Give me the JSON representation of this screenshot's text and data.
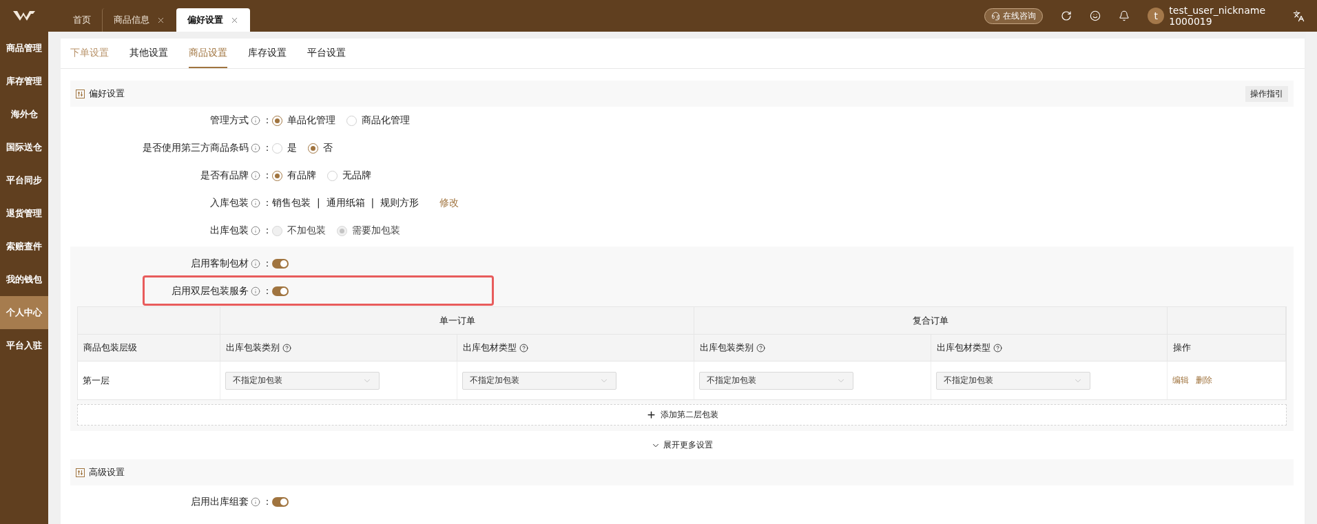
{
  "top_bar": {
    "tabs": [
      {
        "label": "首页",
        "selected": false,
        "closable": false
      },
      {
        "label": "商品信息",
        "selected": false,
        "closable": true
      },
      {
        "label": "偏好设置",
        "selected": true,
        "closable": true
      }
    ],
    "consult_button": "在线咨询",
    "user": {
      "avatar": "t",
      "name": "test_user_nickname",
      "id": "1000019"
    }
  },
  "sidebar": {
    "items": [
      {
        "label": "商品管理",
        "selected": false
      },
      {
        "label": "库存管理",
        "selected": false
      },
      {
        "label": "海外仓",
        "selected": false
      },
      {
        "label": "国际送仓",
        "selected": false
      },
      {
        "label": "平台同步",
        "selected": false
      },
      {
        "label": "退货管理",
        "selected": false
      },
      {
        "label": "索赔查件",
        "selected": false
      },
      {
        "label": "我的钱包",
        "selected": false
      },
      {
        "label": "个人中心",
        "selected": true
      },
      {
        "label": "平台入驻",
        "selected": false
      }
    ]
  },
  "page_tabs": [
    {
      "label": "下单设置",
      "selected": false,
      "hovered": true
    },
    {
      "label": "其他设置",
      "selected": false,
      "hovered": false
    },
    {
      "label": "商品设置",
      "selected": true,
      "hovered": false
    },
    {
      "label": "库存设置",
      "selected": false,
      "hovered": false
    },
    {
      "label": "平台设置",
      "selected": false,
      "hovered": false
    }
  ],
  "preferences": {
    "title": "偏好设置",
    "guide_button": "操作指引",
    "fields": [
      {
        "kind": "radio",
        "label": "管理方式",
        "colon": "：",
        "options": [
          {
            "label": "单品化管理",
            "selected": true,
            "disabled": false
          },
          {
            "label": "商品化管理",
            "selected": false,
            "disabled": false
          }
        ]
      },
      {
        "kind": "radio",
        "label": "是否使用第三方商品条码",
        "colon": "：",
        "options": [
          {
            "label": "是",
            "selected": false,
            "disabled": false
          },
          {
            "label": "否",
            "selected": true,
            "disabled": false
          }
        ]
      },
      {
        "kind": "radio",
        "label": "是否有品牌",
        "colon": "：",
        "options": [
          {
            "label": "有品牌",
            "selected": true,
            "disabled": false
          },
          {
            "label": "无品牌",
            "selected": false,
            "disabled": false
          }
        ]
      },
      {
        "kind": "text",
        "label": "入库包装",
        "colon": "：",
        "value": "销售包装  |  通用纸箱  |  规则方形",
        "link": "修改"
      },
      {
        "kind": "radio",
        "label": "出库包装",
        "colon": "：",
        "options": [
          {
            "label": "不加包装",
            "selected": false,
            "disabled": true
          },
          {
            "label": "需要加包装",
            "selected": true,
            "disabled": true
          }
        ]
      }
    ],
    "panel": {
      "toggles": [
        {
          "label": "启用客制包材",
          "colon": "：",
          "on": true,
          "highlighted": false
        },
        {
          "label": "启用双层包装服务",
          "colon": "：",
          "on": true,
          "highlighted": true
        }
      ],
      "table": {
        "column_groups": [
          "单一订单",
          "复合订单"
        ],
        "columns": [
          {
            "label": "商品包装层级",
            "help": false
          },
          {
            "label": "出库包装类别",
            "help": true
          },
          {
            "label": "出库包材类型",
            "help": true
          },
          {
            "label": "出库包装类别",
            "help": true
          },
          {
            "label": "出库包材类型",
            "help": true
          },
          {
            "label": "操作",
            "help": false
          }
        ],
        "rows": [
          {
            "layer": "第一层",
            "selects": [
              "不指定加包装",
              "不指定加包装",
              "不指定加包装",
              "不指定加包装"
            ],
            "actions": [
              "编辑",
              "删除"
            ]
          }
        ]
      },
      "add_button": "添加第二层包装"
    },
    "expand_link": "展开更多设置"
  },
  "advanced": {
    "title": "高级设置",
    "toggles": [
      {
        "label": "启用出库组套",
        "colon": "：",
        "on": true,
        "highlighted": false
      }
    ]
  }
}
